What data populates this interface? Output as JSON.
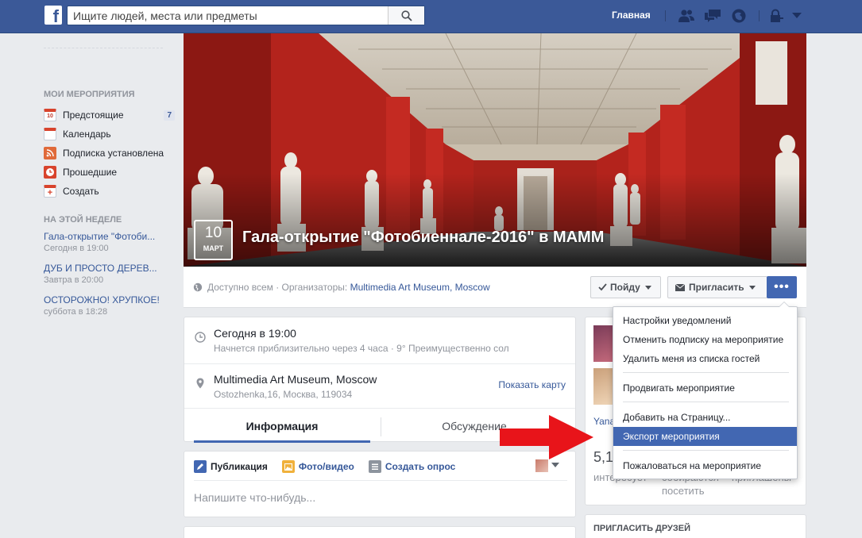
{
  "topbar": {
    "search_placeholder": "Ищите людей, места или предметы",
    "home_label": "Главная",
    "icons": [
      "facebook-logo",
      "search-icon",
      "friend-requests-icon",
      "messages-icon",
      "notifications-icon",
      "privacy-lock-icon",
      "account-menu-icon"
    ],
    "color": "#3b5998"
  },
  "sidebar": {
    "my_events_title": "МОИ МЕРОПРИЯТИЯ",
    "items": [
      {
        "label": "Предстоящие",
        "icon": "calendar-10-icon",
        "count": "7"
      },
      {
        "label": "Календарь",
        "icon": "calendar-icon"
      },
      {
        "label": "Подписка установлена",
        "icon": "rss-icon"
      },
      {
        "label": "Прошедшие",
        "icon": "clock-icon"
      },
      {
        "label": "Создать",
        "icon": "plus-icon"
      }
    ],
    "this_week_title": "НА ЭТОЙ НЕДЕЛЕ",
    "week_events": [
      {
        "title": "Гала-открытие \"Фотоби...",
        "time": "Сегодня в 19:00"
      },
      {
        "title": "ДУБ И ПРОСТО ДЕРЕВ...",
        "time": "Завтра в 20:00"
      },
      {
        "title": "ОСТОРОЖНО! ХРУПКОЕ!",
        "time": "суббота в 18:28"
      }
    ]
  },
  "event": {
    "date_day": "10",
    "date_month": "МАРТ",
    "title": "Гала-открытие \"Фотобиеннале-2016\" в МАММ",
    "privacy": "Доступно всем · Организаторы:",
    "organizer": "Multimedia Art Museum, Moscow",
    "go_button": "Пойду",
    "invite_button": "Пригласить",
    "more_button": "•••"
  },
  "info": {
    "time_main": "Сегодня в 19:00",
    "time_sub": "Начнется приблизительно через 4 часа · 9° Преимущественно сол",
    "place_main": "Multimedia Art Museum, Moscow",
    "place_sub": "Ostozhenka,16, Москва, 119034",
    "show_map": "Показать карту",
    "tabs": [
      "Информация",
      "Обсуждение"
    ]
  },
  "composer": {
    "publish": "Публикация",
    "photo_video": "Фото/видео",
    "poll": "Создать опрос",
    "placeholder": "Напишите что-нибудь..."
  },
  "right": {
    "name": "Yana",
    "count": "5,1",
    "label_interested": "интересует",
    "label_going": "собираются",
    "label_invited": "приглашены",
    "label_visit": "посетить",
    "invite_friends": "ПРИГЛАСИТЬ ДРУЗЕЙ"
  },
  "dropdown": {
    "items": [
      "Настройки уведомлений",
      "Отменить подписку на мероприятие",
      "Удалить меня из списка гостей",
      "Продвигать мероприятие",
      "Добавить на Страницу...",
      "Экспорт мероприятия",
      "Пожаловаться на мероприятие"
    ],
    "active_index": 5,
    "active_color": "#4267b2"
  },
  "annotation": {
    "arrow_color": "#e8141a"
  }
}
